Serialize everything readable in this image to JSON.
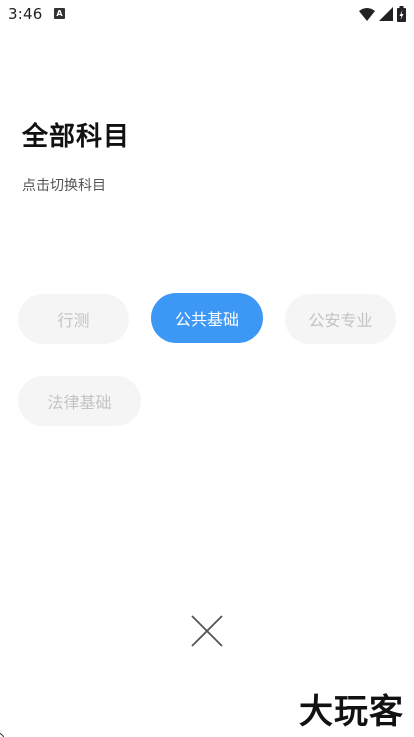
{
  "status_bar": {
    "time": "3:46",
    "notification_icon": "a-badge-icon",
    "notification_glyph": "A",
    "icons": [
      "wifi-icon",
      "signal-icon",
      "battery-icon"
    ]
  },
  "header": {
    "title": "全部科目",
    "subtitle": "点击切换科目"
  },
  "subjects": [
    {
      "label": "行测",
      "selected": false
    },
    {
      "label": "公共基础",
      "selected": true
    },
    {
      "label": "公安专业",
      "selected": false
    },
    {
      "label": "法律基础",
      "selected": false
    }
  ],
  "close": {
    "icon": "close-icon"
  },
  "watermark": {
    "text": "大玩客"
  },
  "colors": {
    "accent": "#3d98f5",
    "chip_bg": "#f5f5f5",
    "chip_text": "#c3c3c3",
    "title": "#111111"
  }
}
